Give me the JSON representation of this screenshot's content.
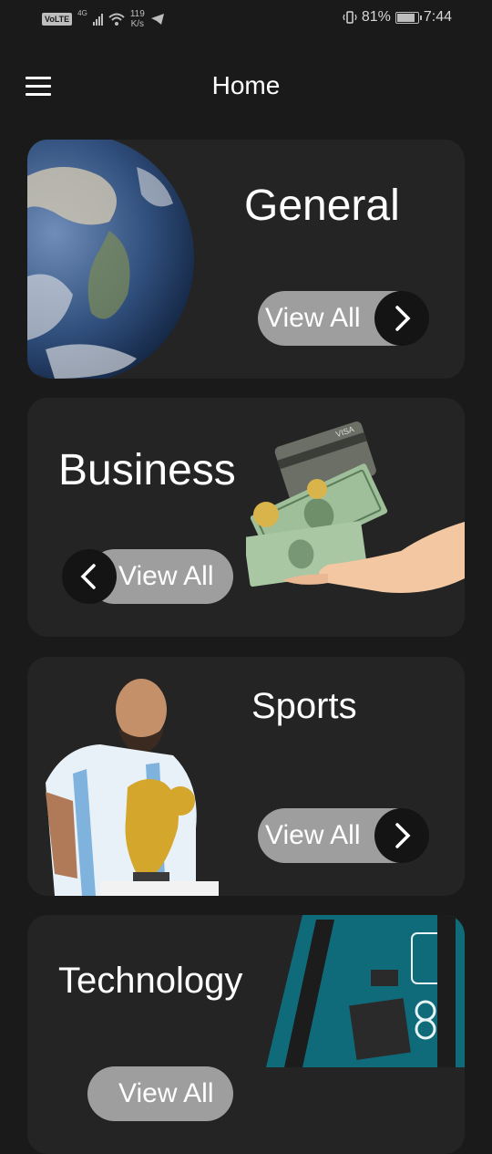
{
  "status_bar": {
    "volte": "VoLTE",
    "network": "4G",
    "speed_value": "119",
    "speed_unit": "K/s",
    "battery": "81%",
    "battery_level": 0.81,
    "time": "7:44"
  },
  "app_bar": {
    "title": "Home",
    "menu_icon": "hamburger-menu-icon"
  },
  "categories": [
    {
      "title": "General",
      "button": "View All",
      "image": "earth-globe"
    },
    {
      "title": "Business",
      "button": "View All",
      "image": "hand-with-money-and-card"
    },
    {
      "title": "Sports",
      "button": "View All",
      "image": "footballer-with-trophy"
    },
    {
      "title": "Technology",
      "button": "View All",
      "image": "arduino-mega-board"
    }
  ],
  "icons": {
    "next": "chevron-right-icon",
    "prev": "chevron-left-icon"
  },
  "colors": {
    "background": "#1a1a1a",
    "card": "#242424",
    "pill": "#9e9e9e",
    "pill_circle": "#141414",
    "text": "#ffffff"
  }
}
